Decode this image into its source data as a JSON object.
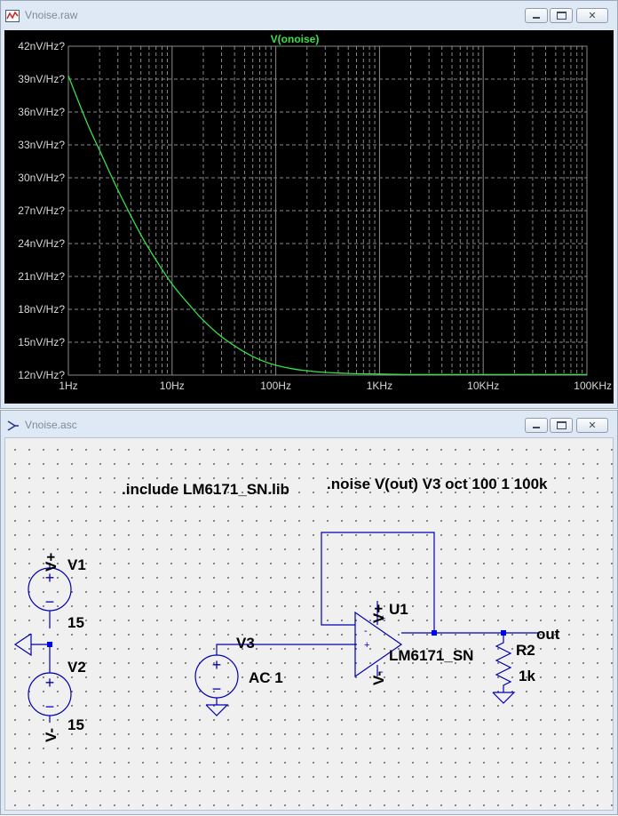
{
  "plot_window": {
    "title": "Vnoise.raw",
    "trace_label": "V(onoise)",
    "colors": {
      "background": "#000000",
      "trace": "#37e04a",
      "grid": "#8a8a8a",
      "axis_text": "#d8d8d8",
      "trace_label": "#37e04a"
    }
  },
  "chart_data": {
    "type": "line",
    "title": "V(onoise)",
    "x_scale": "log",
    "xlim": [
      1,
      100000
    ],
    "ylim": [
      12,
      42
    ],
    "x_ticks": [
      "1Hz",
      "10Hz",
      "100Hz",
      "1KHz",
      "10KHz",
      "100KHz"
    ],
    "y_ticks": [
      "42nV/Hz?",
      "39nV/Hz?",
      "36nV/Hz?",
      "33nV/Hz?",
      "30nV/Hz?",
      "27nV/Hz?",
      "24nV/Hz?",
      "21nV/Hz?",
      "18nV/Hz?",
      "15nV/Hz?",
      "12nV/Hz?"
    ],
    "grid": true,
    "series": [
      {
        "name": "V(onoise)",
        "x": [
          1,
          1.5,
          2,
          3,
          5,
          7,
          10,
          15,
          20,
          30,
          50,
          70,
          100,
          150,
          200,
          300,
          500,
          1000,
          2000,
          5000,
          10000,
          100000
        ],
        "y": [
          39.3,
          35.1,
          32.5,
          28.9,
          24.8,
          22.5,
          20.3,
          18.3,
          17.0,
          15.5,
          14.1,
          13.4,
          12.9,
          12.55,
          12.4,
          12.25,
          12.15,
          12.1,
          12.05,
          12.05,
          12.05,
          12.05
        ]
      }
    ]
  },
  "sch_window": {
    "title": "Vnoise.asc",
    "directives": {
      "include": ".include LM6171_SN.lib",
      "noise": ".noise V(out) V3 oct 100 1 100k"
    },
    "labels": {
      "vplus_rail": "V+",
      "vminus_rail": "V-",
      "v1_name": "V1",
      "v1_value": "15",
      "v2_name": "V2",
      "v2_value": "15",
      "v3_name": "V3",
      "v3_value": "AC 1",
      "u1_name": "U1",
      "u1_model": "LM6171_SN",
      "opamp_vplus": "V+",
      "opamp_vminus": "V-",
      "r2_name": "R2",
      "r2_value": "1k",
      "out_label": "out",
      "plus_sign": "+",
      "minus_sign": "−",
      "pin_plus": "+",
      "pin_minus": "-"
    },
    "colors": {
      "wire": "#0000b0",
      "component": "#0000b0",
      "text": "#000000",
      "node_dot": "#0000ff"
    }
  }
}
